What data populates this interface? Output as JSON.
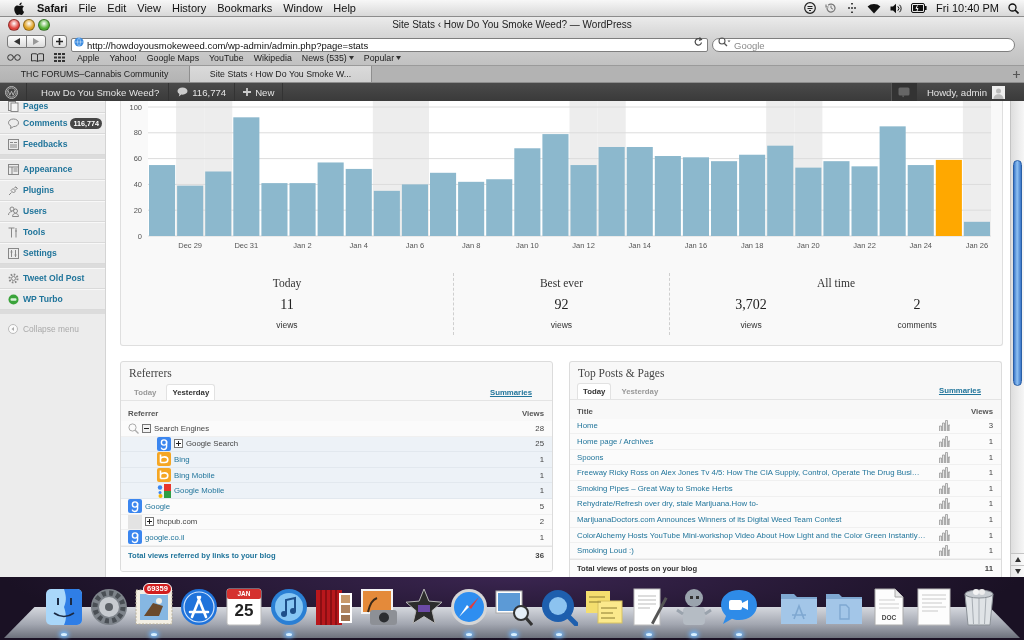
{
  "menubar": {
    "app": "Safari",
    "menus": [
      "File",
      "Edit",
      "View",
      "History",
      "Bookmarks",
      "Window",
      "Help"
    ],
    "clock": "Fri 10:40 PM"
  },
  "browser": {
    "title": "Site Stats ‹ How Do You Smoke Weed? — WordPress",
    "url": "http://howdoyousmokeweed.com/wp-admin/admin.php?page=stats",
    "search": {
      "placeholder": "Google"
    },
    "bookmarks": [
      {
        "label": "Apple",
        "menu": false
      },
      {
        "label": "Yahoo!",
        "menu": false
      },
      {
        "label": "Google Maps",
        "menu": false
      },
      {
        "label": "YouTube",
        "menu": false
      },
      {
        "label": "Wikipedia",
        "menu": false
      },
      {
        "label": "News (535)",
        "menu": true
      },
      {
        "label": "Popular",
        "menu": true
      }
    ],
    "tabs": [
      {
        "label": "THC FORUMS–Cannabis Community",
        "selected": false
      },
      {
        "label": "Site Stats ‹ How Do You Smoke W...",
        "selected": true
      }
    ]
  },
  "admin_bar": {
    "site": "How Do You Smoke Weed?",
    "comments": "116,774",
    "new": "New",
    "greeting": "Howdy, admin"
  },
  "sidebar": {
    "sections": [
      {
        "items": [
          {
            "kind": "pages",
            "label": "Pages"
          },
          {
            "kind": "comments",
            "label": "Comments",
            "badge": "116,774"
          },
          {
            "kind": "feedback",
            "label": "Feedbacks"
          }
        ]
      },
      {
        "items": [
          {
            "kind": "appearance",
            "label": "Appearance"
          },
          {
            "kind": "plugins",
            "label": "Plugins"
          },
          {
            "kind": "users",
            "label": "Users"
          },
          {
            "kind": "tools",
            "label": "Tools"
          },
          {
            "kind": "settings",
            "label": "Settings"
          }
        ]
      },
      {
        "items": [
          {
            "kind": "gear",
            "label": "Tweet Old Post"
          },
          {
            "kind": "turbo",
            "label": "WP Turbo"
          }
        ]
      }
    ],
    "collapse": "Collapse menu"
  },
  "stats": {
    "chart_data": {
      "type": "bar",
      "categories": [
        null,
        "Dec 29",
        null,
        "Dec 31",
        null,
        "Jan 2",
        null,
        "Jan 4",
        null,
        "Jan 6",
        null,
        "Jan 8",
        null,
        "Jan 10",
        null,
        "Jan 12",
        null,
        "Jan 14",
        null,
        "Jan 16",
        null,
        "Jan 18",
        null,
        "Jan 20",
        null,
        "Jan 22",
        null,
        "Jan 24",
        null,
        "Jan 26"
      ],
      "series": [
        {
          "color": "#8cb8cd",
          "values": [
            55,
            39,
            50,
            92,
            41,
            41,
            57,
            52,
            35,
            40,
            49,
            42,
            44,
            68,
            79,
            55,
            69,
            69,
            62,
            61,
            58,
            63,
            70,
            53,
            58,
            54,
            85,
            55,
            0,
            11
          ]
        },
        {
          "color": "#ffa800",
          "values": [
            0,
            0,
            0,
            0,
            0,
            0,
            0,
            0,
            0,
            0,
            0,
            0,
            0,
            0,
            0,
            0,
            0,
            0,
            0,
            0,
            0,
            0,
            0,
            0,
            0,
            0,
            0,
            0,
            59,
            0
          ]
        }
      ],
      "stacked": true,
      "ylim": [
        0,
        100
      ],
      "yticks": [
        0,
        20,
        40,
        60,
        80,
        100
      ],
      "grid": true
    },
    "shaded_days": [
      false,
      true,
      true,
      false,
      false,
      false,
      false,
      false,
      true,
      true,
      false,
      false,
      false,
      false,
      false,
      true,
      true,
      false,
      false,
      false,
      false,
      false,
      true,
      true,
      false,
      false,
      false,
      false,
      false,
      true
    ],
    "summary": [
      {
        "title": "Today",
        "figures": [
          {
            "value": "11",
            "unit": "views"
          }
        ]
      },
      {
        "title": "Best ever",
        "figures": [
          {
            "value": "92",
            "unit": "views"
          }
        ]
      },
      {
        "title": "All time",
        "figures": [
          {
            "value": "3,702",
            "unit": "views"
          },
          {
            "value": "2",
            "unit": "comments"
          }
        ]
      }
    ]
  },
  "referrers": {
    "title": "Referrers",
    "tabs": [
      {
        "label": "Today",
        "selected": false
      },
      {
        "label": "Yesterday",
        "selected": true
      }
    ],
    "link": "Summaries",
    "columns": [
      "Referrer",
      "Views"
    ],
    "rows": [
      {
        "kind": "group",
        "name": "Search Engines",
        "views": "28",
        "link": false,
        "expanded": true,
        "children": [
          {
            "kind": "google",
            "name": "Google Search",
            "views": "25",
            "link": false,
            "expanded": false
          },
          {
            "kind": "bing",
            "name": "Bing",
            "views": "1",
            "link": true
          },
          {
            "kind": "bing",
            "name": "Bing Mobile",
            "views": "1",
            "link": true
          },
          {
            "kind": "googlemobile",
            "name": "Google Mobile",
            "views": "1",
            "link": true
          }
        ]
      },
      {
        "kind": "google",
        "name": "Google",
        "views": "5",
        "link": true
      },
      {
        "kind": "site",
        "name": "thcpub.com",
        "views": "2",
        "link": false,
        "expanded": false
      },
      {
        "kind": "google",
        "name": "google.co.il",
        "views": "1",
        "link": true
      }
    ],
    "total": {
      "label": "Total views referred by links to your blog",
      "views": "36"
    }
  },
  "top_posts": {
    "title": "Top Posts & Pages",
    "tabs": [
      {
        "label": "Today",
        "selected": true
      },
      {
        "label": "Yesterday",
        "selected": false
      }
    ],
    "link": "Summaries",
    "columns": [
      "Title",
      "Views"
    ],
    "rows": [
      {
        "title": "Home",
        "views": "3"
      },
      {
        "title": "Home page / Archives",
        "views": "1"
      },
      {
        "title": "Spoons",
        "views": "1"
      },
      {
        "title": "Freeway Ricky Ross on Alex Jones Tv 4/5: How The CIA Supply, Control, Operate The Drug Busi…",
        "views": "1"
      },
      {
        "title": "Smoking Pipes – Great Way to Smoke Herbs",
        "views": "1"
      },
      {
        "title": "Rehydrate/Refresh over dry, stale Marijuana.How to-",
        "views": "1"
      },
      {
        "title": "MarijuanaDoctors.com Announces Winners of its Digital Weed Team Contest",
        "views": "1"
      },
      {
        "title": "ColorAlchemy Hosts YouTube Mini-workshop Video About How Light and the Color Green Instantly…",
        "views": "1"
      },
      {
        "title": "Smoking Loud :)",
        "views": "1"
      }
    ],
    "total": {
      "label": "Total views of posts on your blog",
      "views": "11"
    }
  },
  "dock": {
    "apps": [
      {
        "kind": "finder",
        "running": true
      },
      {
        "kind": "settings",
        "running": false
      },
      {
        "kind": "mail",
        "running": true,
        "badge": "69359"
      },
      {
        "kind": "appstore",
        "running": false
      },
      {
        "kind": "calendar",
        "running": false,
        "month": "JAN",
        "day": "25"
      },
      {
        "kind": "music",
        "running": true
      },
      {
        "kind": "photobooth",
        "running": false
      },
      {
        "kind": "photos",
        "running": false
      },
      {
        "kind": "movie",
        "running": false
      },
      {
        "kind": "browser",
        "running": true
      },
      {
        "kind": "preview",
        "running": true
      },
      {
        "kind": "player",
        "running": true
      },
      {
        "kind": "notes",
        "running": false
      },
      {
        "kind": "textedit",
        "running": true
      },
      {
        "kind": "robot",
        "running": true
      },
      {
        "kind": "video",
        "running": true
      }
    ],
    "stacks": [
      {
        "kind": "appsfolder"
      },
      {
        "kind": "docsfolder"
      },
      {
        "kind": "doc",
        "label": "DOC"
      },
      {
        "kind": "document"
      },
      {
        "kind": "trash"
      }
    ]
  }
}
